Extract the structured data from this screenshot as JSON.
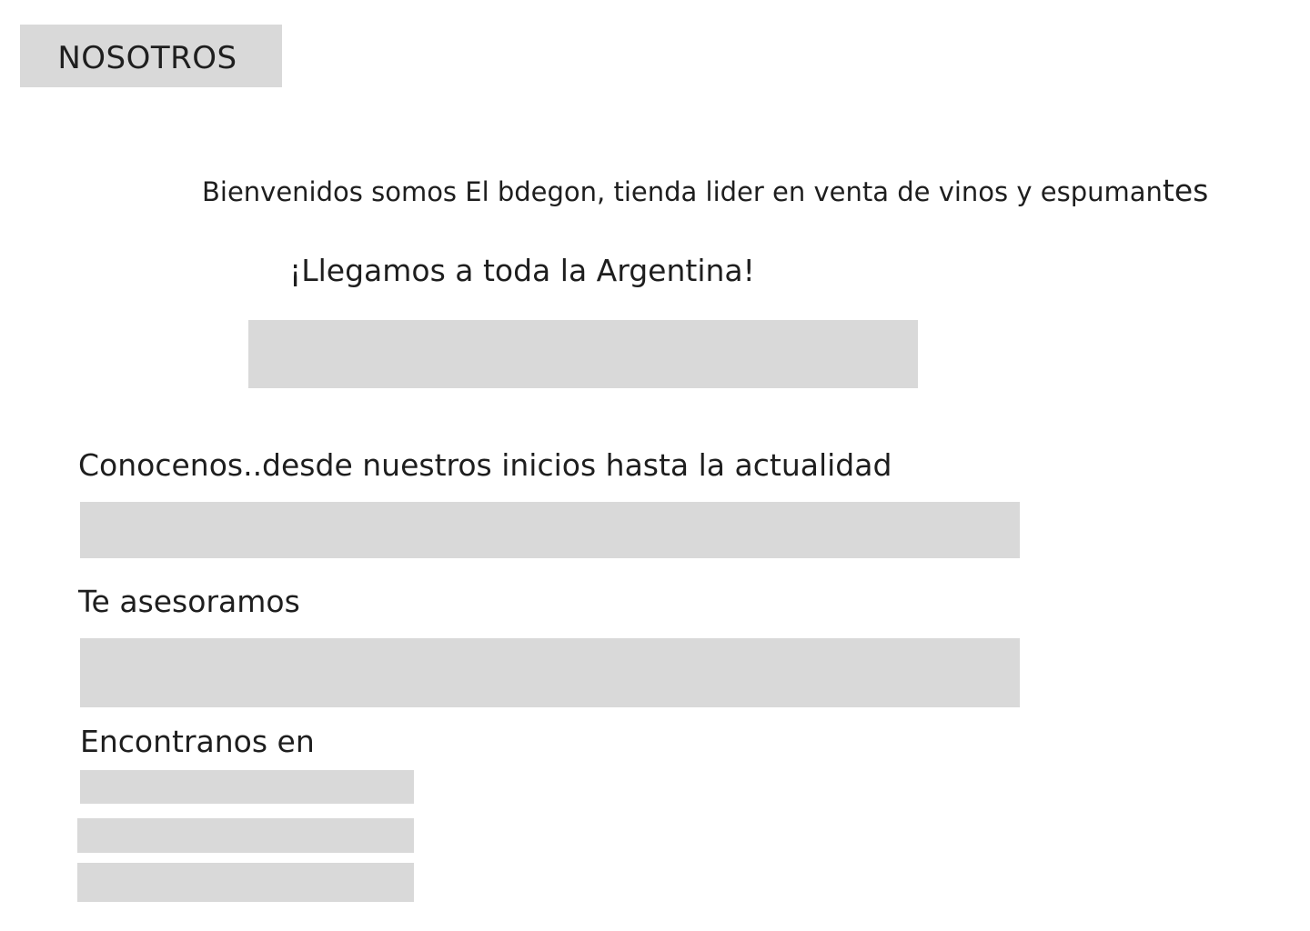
{
  "nav": {
    "label": "NOSOTROS"
  },
  "intro": {
    "welcome_main": "Bienvenidos somos El bdegon, tienda lider en venta de vinos y espuman",
    "welcome_tail": "tes",
    "reach": "¡Llegamos a toda la Argentina!"
  },
  "sections": {
    "history_title": "Conocenos..desde nuestros inicios hasta la actualidad",
    "advise_title": "Te asesoramos",
    "find_title": "Encontranos en"
  }
}
